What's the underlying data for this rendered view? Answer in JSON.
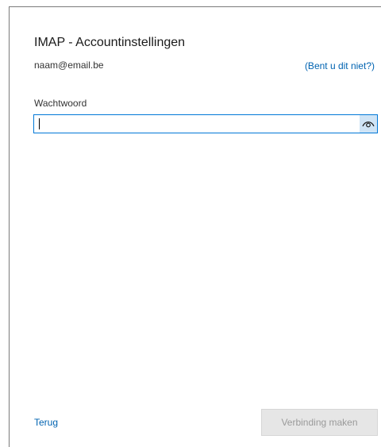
{
  "dialog": {
    "title": "IMAP - Accountinstellingen",
    "email": "naam@email.be",
    "not_you_link": "(Bent u dit niet?)"
  },
  "password": {
    "label": "Wachtwoord",
    "value": "",
    "placeholder": "",
    "reveal_icon": "eye-icon"
  },
  "footer": {
    "back_label": "Terug",
    "connect_label": "Verbinding maken",
    "connect_disabled": true
  },
  "colors": {
    "link": "#0063b1",
    "focus_border": "#0078d7",
    "reveal_button_bg": "#cfe4f6",
    "disabled_button_bg": "#e6e6e6",
    "disabled_button_text": "#9a9a9a"
  }
}
